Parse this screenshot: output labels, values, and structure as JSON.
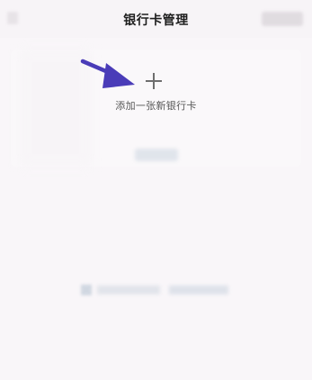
{
  "header": {
    "title": "银行卡管理"
  },
  "add_card": {
    "label": "添加一张新银行卡"
  },
  "icons": {
    "back": "back-arrow-icon",
    "plus": "plus-icon",
    "annotation_arrow": "arrow-pointer-icon",
    "bottom_link": "link-icon"
  },
  "colors": {
    "background": "#f9f6f9",
    "title_text": "#1d1d1d",
    "label_text": "#565656",
    "annotation_arrow": "#4a3cb8"
  }
}
